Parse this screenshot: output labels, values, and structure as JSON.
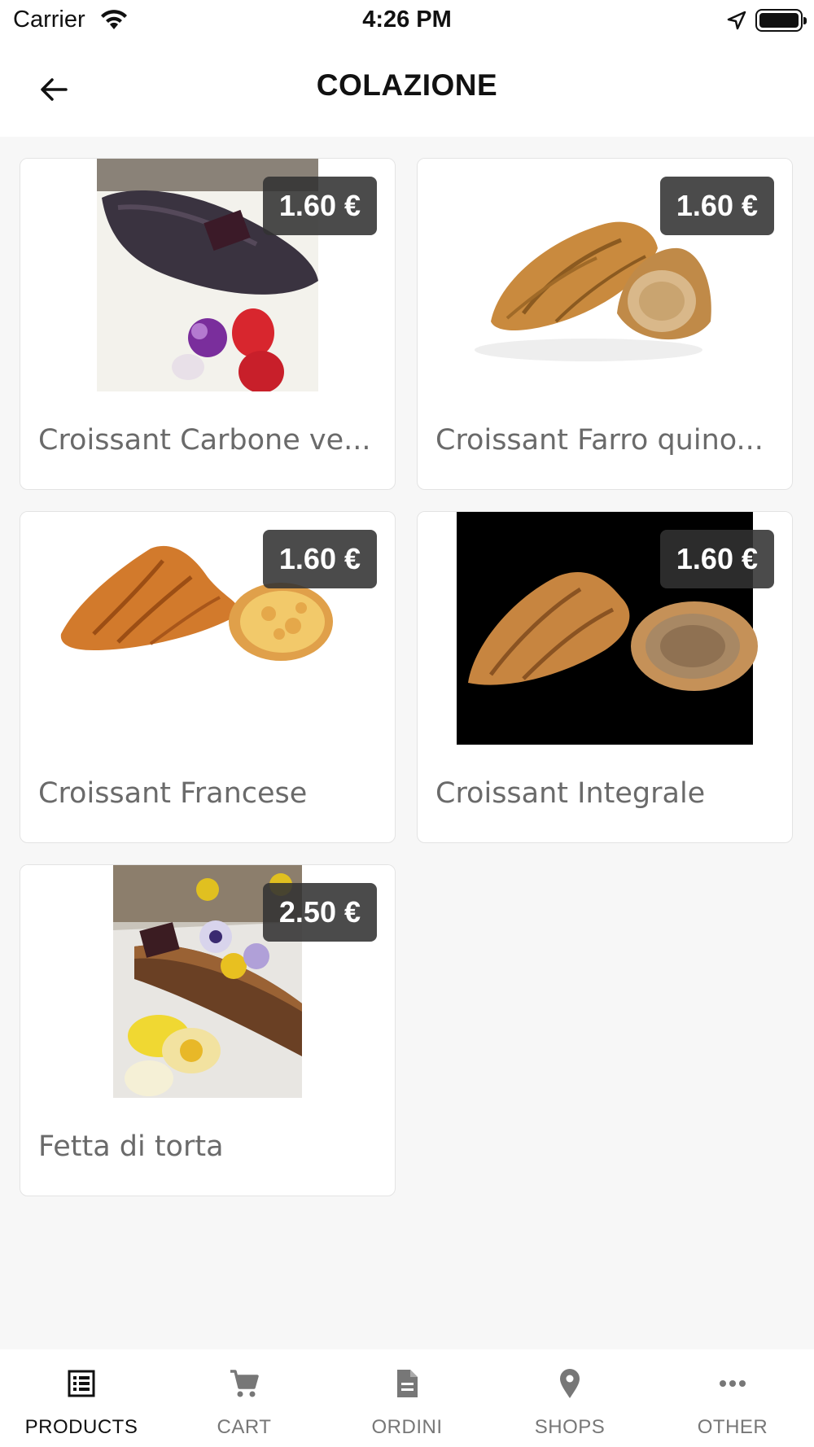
{
  "status_bar": {
    "carrier": "Carrier",
    "time": "4:26 PM",
    "icons": [
      "wifi-icon",
      "location-arrow-icon",
      "battery-icon"
    ]
  },
  "header": {
    "title": "COLAZIONE",
    "back_icon": "arrow-left-icon"
  },
  "products": [
    {
      "name": "Croissant Carbone ve...",
      "price": "1.60 €",
      "image": "charcoal-croissant-with-strawberries"
    },
    {
      "name": "Croissant Farro quino...",
      "price": "1.60 €",
      "image": "spelt-quinoa-croissant"
    },
    {
      "name": "Croissant Francese",
      "price": "1.60 €",
      "image": "french-croissant"
    },
    {
      "name": "Croissant Integrale",
      "price": "1.60 €",
      "image": "wholegrain-croissant-black-background"
    },
    {
      "name": "Fetta di torta",
      "price": "2.50 €",
      "image": "cake-slice-with-macarons"
    }
  ],
  "tab_bar": {
    "tabs": [
      {
        "label": "PRODUCTS",
        "icon": "list-icon",
        "active": true
      },
      {
        "label": "CART",
        "icon": "cart-icon",
        "active": false
      },
      {
        "label": "ORDINI",
        "icon": "document-icon",
        "active": false
      },
      {
        "label": "SHOPS",
        "icon": "map-pin-icon",
        "active": false
      },
      {
        "label": "OTHER",
        "icon": "more-dots-icon",
        "active": false
      }
    ]
  },
  "colors": {
    "badge_bg": "#323232",
    "active_tab": "#111111",
    "inactive_tab": "#777777"
  }
}
